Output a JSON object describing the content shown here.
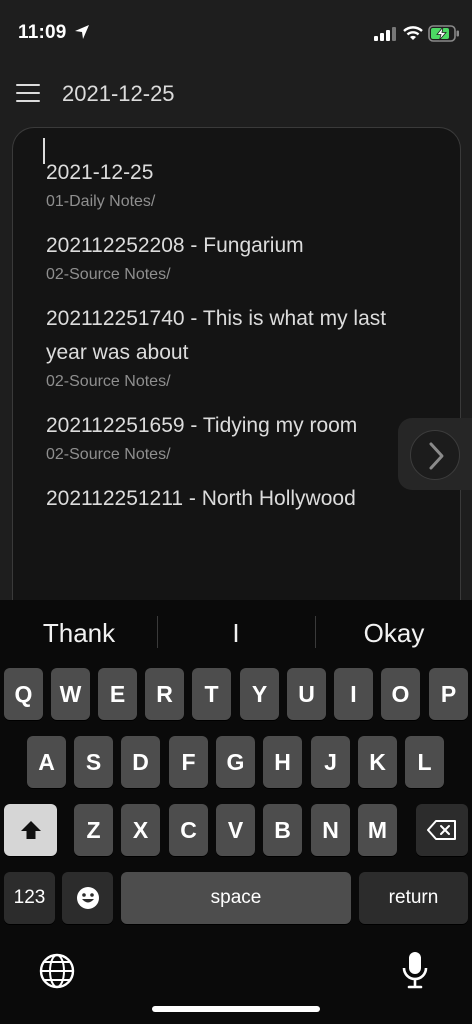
{
  "status_bar": {
    "time": "11:09"
  },
  "header": {
    "title": "2021-12-25"
  },
  "suggestions": [
    {
      "title": "2021-12-25",
      "path": "01-Daily Notes/"
    },
    {
      "title": "202112252208 - Fungarium",
      "path": "02-Source Notes/"
    },
    {
      "title": "202112251740 - This is what my last year was about",
      "path": "02-Source Notes/"
    },
    {
      "title": "202112251659 - Tidying my room",
      "path": "02-Source Notes/"
    },
    {
      "title": "202112251211 - North Hollywood",
      "path": ""
    }
  ],
  "keyboard": {
    "predictions": [
      "Thank",
      "I",
      "Okay"
    ],
    "row1": [
      "Q",
      "W",
      "E",
      "R",
      "T",
      "Y",
      "U",
      "I",
      "O",
      "P"
    ],
    "row2": [
      "A",
      "S",
      "D",
      "F",
      "G",
      "H",
      "J",
      "K",
      "L"
    ],
    "row3": [
      "Z",
      "X",
      "C",
      "V",
      "B",
      "N",
      "M"
    ],
    "numbers_label": "123",
    "space_label": "space",
    "return_label": "return"
  }
}
